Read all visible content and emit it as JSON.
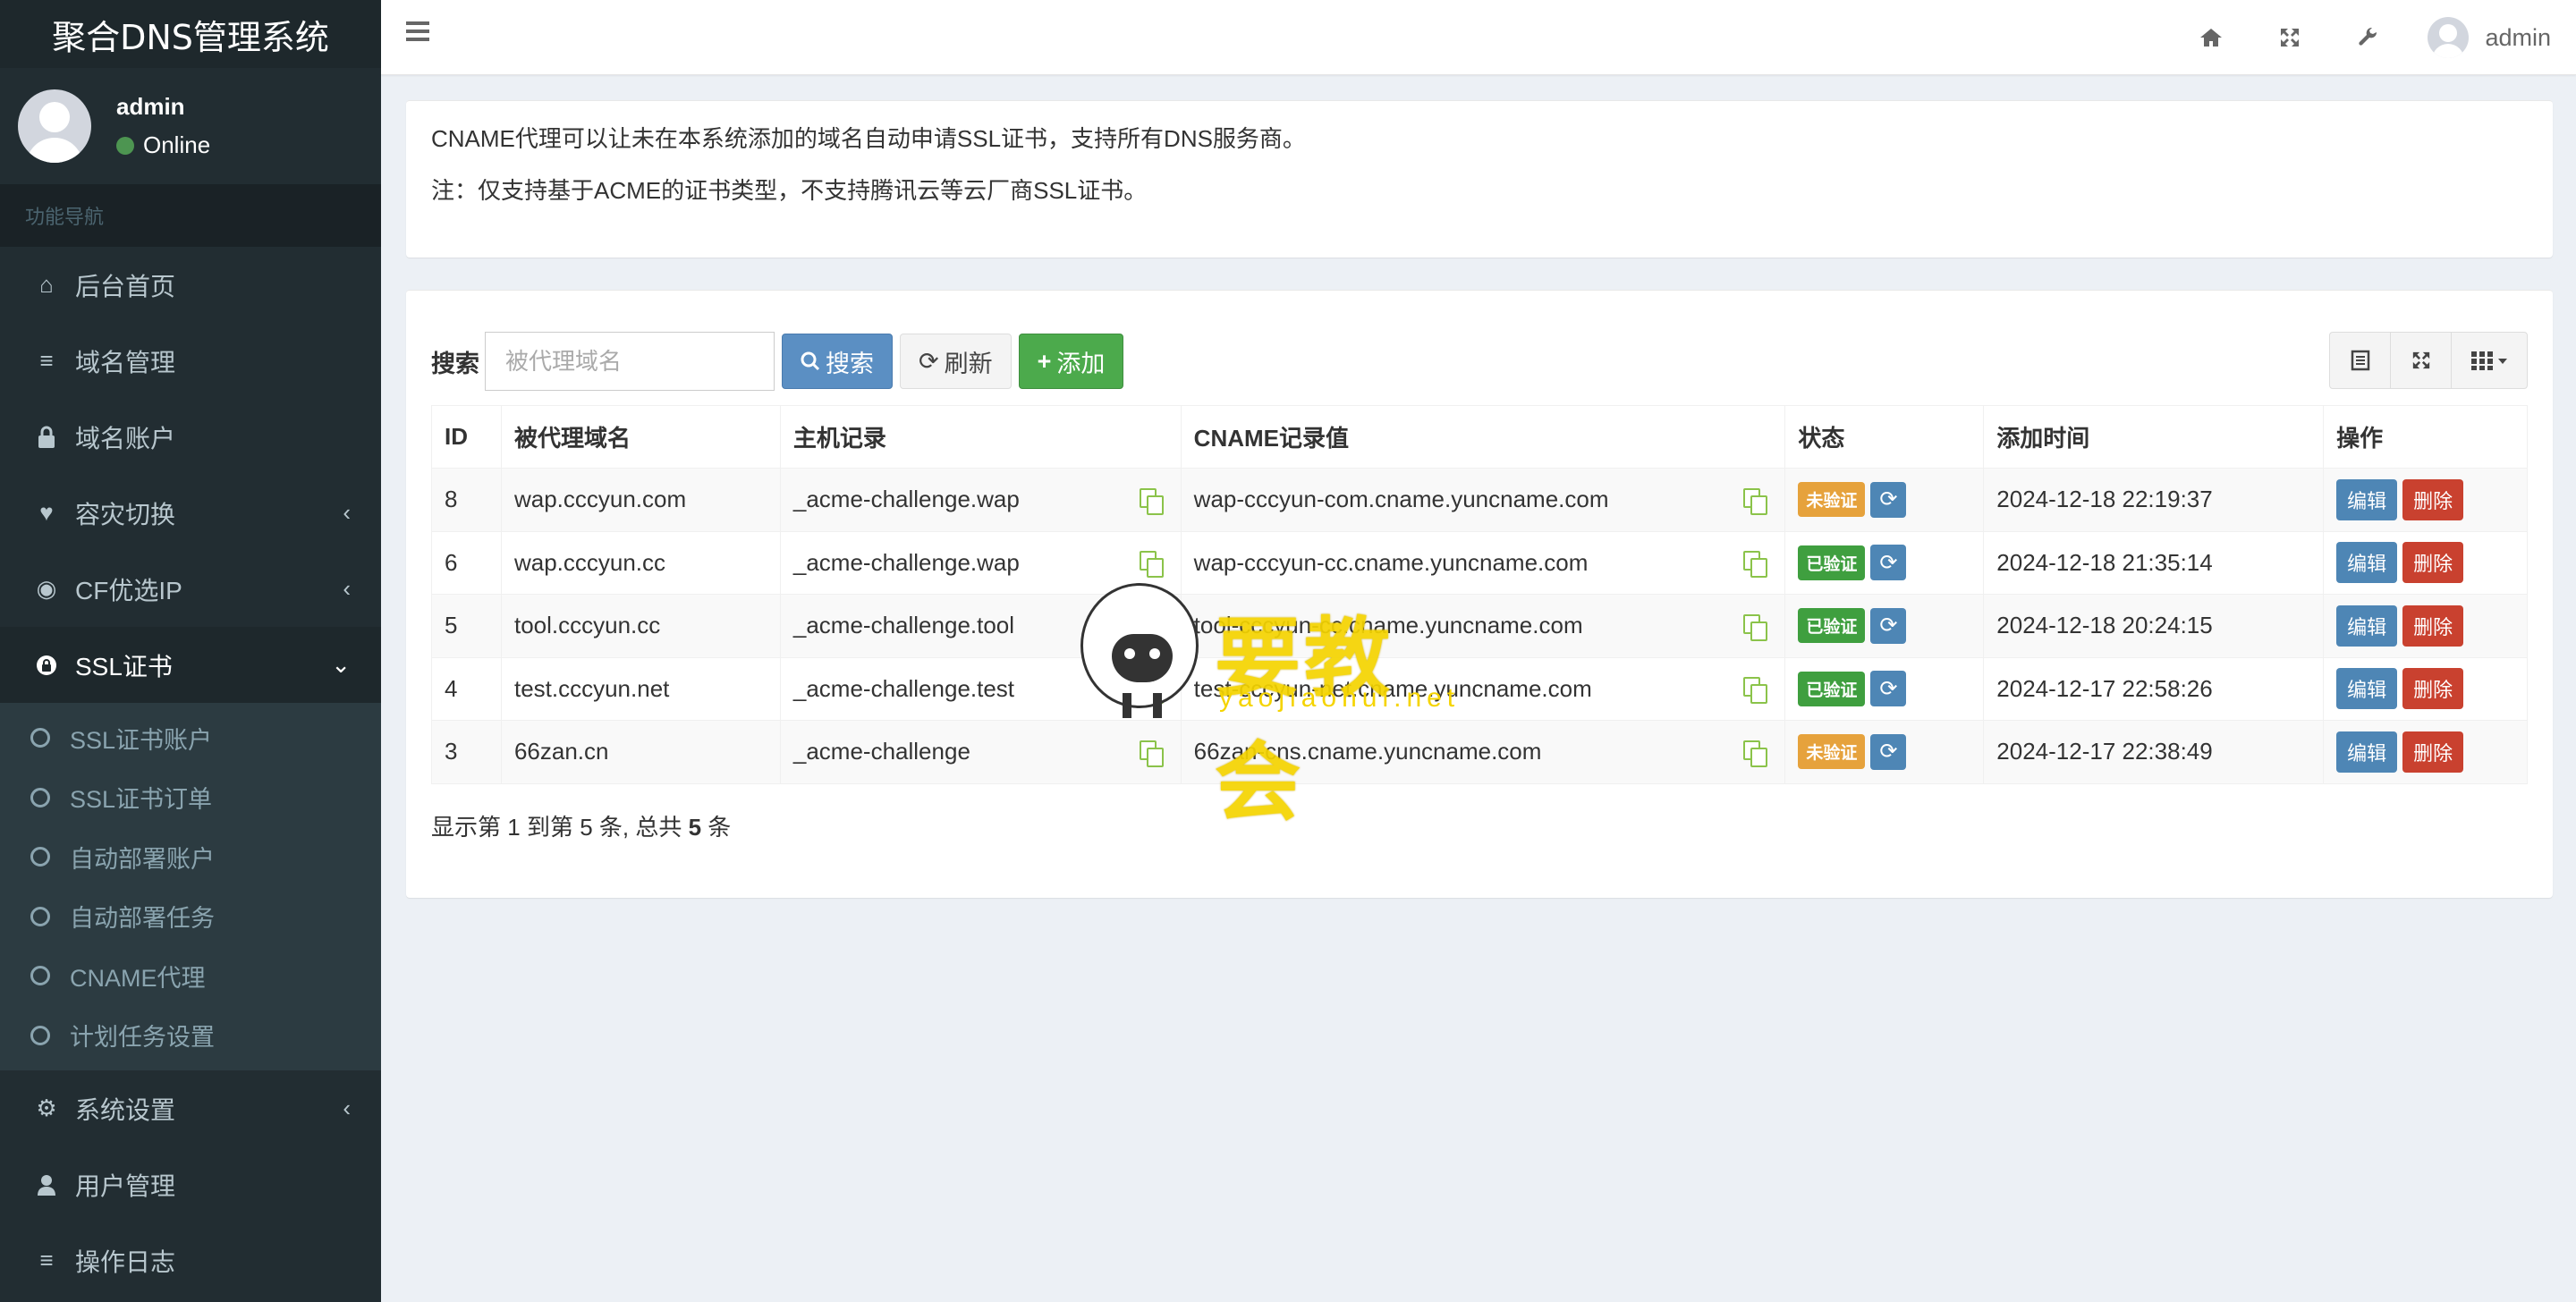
{
  "app_title": "聚合DNS管理系统",
  "user": {
    "name": "admin",
    "status": "Online"
  },
  "nav_header": "功能导航",
  "nav": [
    {
      "icon": "home-icon",
      "glyph": "⌂",
      "label": "后台首页"
    },
    {
      "icon": "list-icon",
      "glyph": "≡",
      "label": "域名管理"
    },
    {
      "icon": "lock-icon",
      "glyph": "🔒",
      "label": "域名账户"
    },
    {
      "icon": "heartbeat-icon",
      "glyph": "♥",
      "label": "容灾切换"
    },
    {
      "icon": "globe-icon",
      "glyph": "◉",
      "label": "CF优选IP"
    },
    {
      "icon": "lock-icon",
      "glyph": "🔒",
      "label": "SSL证书"
    },
    {
      "icon": "cogs-icon",
      "glyph": "⚙",
      "label": "系统设置"
    },
    {
      "icon": "user-icon",
      "glyph": "👤",
      "label": "用户管理"
    },
    {
      "icon": "list-icon",
      "glyph": "≡",
      "label": "操作日志"
    }
  ],
  "ssl_sub": [
    "SSL证书账户",
    "SSL证书订单",
    "自动部署账户",
    "自动部署任务",
    "CNAME代理",
    "计划任务设置"
  ],
  "header": {
    "user": "admin"
  },
  "notice": {
    "line1": "CNAME代理可以让未在本系统添加的域名自动申请SSL证书，支持所有DNS服务商。",
    "line2": "注：仅支持基于ACME的证书类型，不支持腾讯云等云厂商SSL证书。"
  },
  "toolbar": {
    "search_label": "搜索",
    "search_placeholder": "被代理域名",
    "search_btn": "搜索",
    "refresh_btn": "刷新",
    "add_btn": "添加"
  },
  "table": {
    "headers": [
      "ID",
      "被代理域名",
      "主机记录",
      "CNAME记录值",
      "状态",
      "添加时间",
      "操作"
    ],
    "rows": [
      {
        "id": "8",
        "domain": "wap.cccyun.com",
        "host": "_acme-challenge.wap",
        "cname": "wap-cccyun-com.cname.yuncname.com",
        "status": "未验证",
        "status_type": "warning",
        "time": "2024-12-18 22:19:37"
      },
      {
        "id": "6",
        "domain": "wap.cccyun.cc",
        "host": "_acme-challenge.wap",
        "cname": "wap-cccyun-cc.cname.yuncname.com",
        "status": "已验证",
        "status_type": "success",
        "time": "2024-12-18 21:35:14"
      },
      {
        "id": "5",
        "domain": "tool.cccyun.cc",
        "host": "_acme-challenge.tool",
        "cname": "tool-cccyun-cc.cname.yuncname.com",
        "status": "已验证",
        "status_type": "success",
        "time": "2024-12-18 20:24:15"
      },
      {
        "id": "4",
        "domain": "test.cccyun.net",
        "host": "_acme-challenge.test",
        "cname": "test-cccyun-net.cname.yuncname.com",
        "status": "已验证",
        "status_type": "success",
        "time": "2024-12-17 22:58:26"
      },
      {
        "id": "3",
        "domain": "66zan.cn",
        "host": "_acme-challenge",
        "cname": "66zan-cns.cname.yuncname.com",
        "status": "未验证",
        "status_type": "warning",
        "time": "2024-12-17 22:38:49"
      }
    ],
    "edit_label": "编辑",
    "delete_label": "删除"
  },
  "pager": {
    "prefix": "显示第",
    "from": "1",
    "mid1": "到第",
    "to": "5",
    "mid2": "条, 总共",
    "total": "5",
    "suffix": "条"
  },
  "watermark": {
    "text": "要教会",
    "sub": "yaojiaohui.net"
  },
  "colors": {
    "sidebar_bg": "#222d32",
    "primary": "#5b8fc3",
    "success": "#4caa4c",
    "danger": "#c9412f",
    "warning": "#e6a23c"
  }
}
